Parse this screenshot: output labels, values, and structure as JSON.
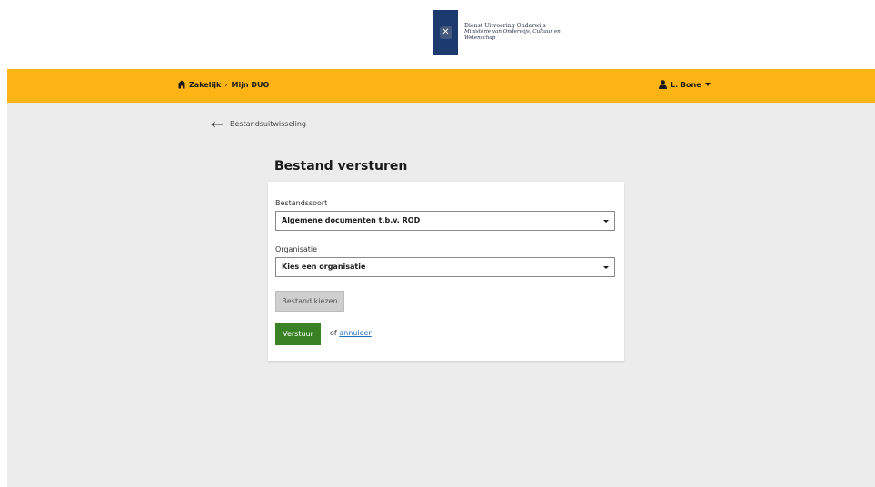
{
  "brand": {
    "line1": "Dienst Uitvoering Onderwijs",
    "line2": "Ministerie van Onderwijs, Cultuur en",
    "line3": "Wetenschap",
    "mark_glyph": "✕",
    "mark_color": "#1d3a6e"
  },
  "nav": {
    "breadcrumb": [
      {
        "label": "Zakelijk"
      },
      {
        "label": "Mijn DUO"
      }
    ],
    "separator": "›",
    "user_name": "L. Bone",
    "bar_color": "#fcb414"
  },
  "back_link": {
    "label": "Bestandsuitwisseling"
  },
  "page": {
    "title": "Bestand versturen"
  },
  "form": {
    "bestandssoort": {
      "label": "Bestandssoort",
      "value": "Algemene documenten t.b.v. ROD"
    },
    "organisatie": {
      "label": "Organisatie",
      "value": "Kies een organisatie"
    },
    "file_button": "Bestand kiezen",
    "send_button": "Verstuur",
    "or_text": "of",
    "cancel_link": "annuleer",
    "send_color": "#398224"
  }
}
